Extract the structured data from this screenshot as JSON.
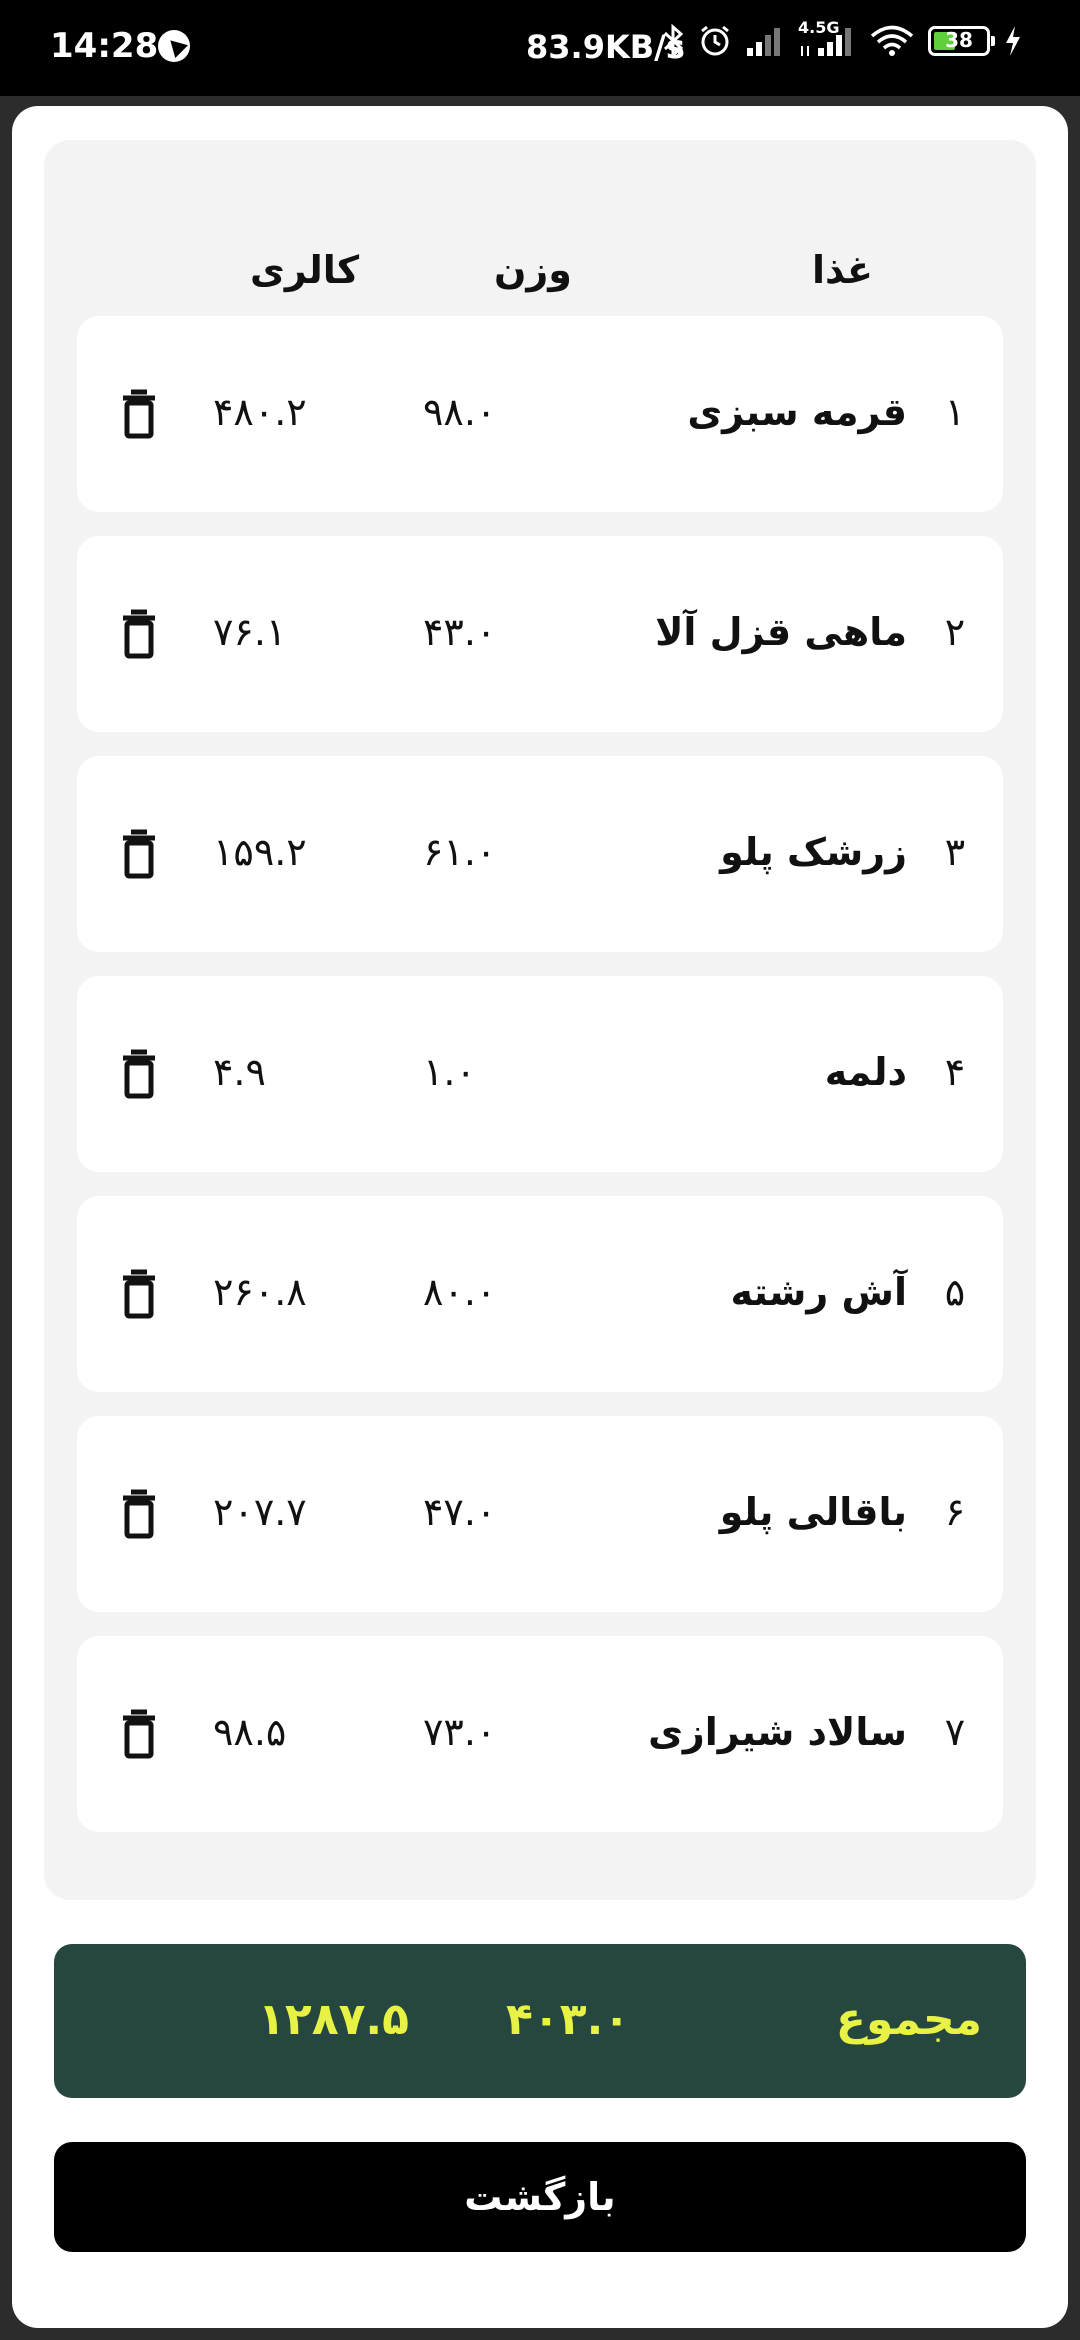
{
  "status_bar": {
    "time": "14:28",
    "speed": "83.9KB/s",
    "network_label": "4.5G",
    "battery": "38"
  },
  "table": {
    "headers": {
      "food": "غذا",
      "weight": "وزن",
      "calories": "کالری"
    },
    "rows": [
      {
        "index": "۱",
        "name": "قرمه سبزی",
        "weight": "۹۸.۰",
        "calories": "۴۸۰.۲"
      },
      {
        "index": "۲",
        "name": "ماهی قزل آلا",
        "weight": "۴۳.۰",
        "calories": "۷۶.۱"
      },
      {
        "index": "۳",
        "name": "زرشک پلو",
        "weight": "۶۱.۰",
        "calories": "۱۵۹.۲"
      },
      {
        "index": "۴",
        "name": "دلمه",
        "weight": "۱.۰",
        "calories": "۴.۹"
      },
      {
        "index": "۵",
        "name": "آش رشته",
        "weight": "۸۰.۰",
        "calories": "۲۶۰.۸"
      },
      {
        "index": "۶",
        "name": "باقالی پلو",
        "weight": "۴۷.۰",
        "calories": "۲۰۷.۷"
      },
      {
        "index": "۷",
        "name": "سالاد شیرازی",
        "weight": "۷۳.۰",
        "calories": "۹۸.۵"
      }
    ]
  },
  "total": {
    "label": "مجموع",
    "weight": "۴۰۳.۰",
    "calories": "۱۲۸۷.۵"
  },
  "back_button": {
    "label": "بازگشت"
  },
  "colors": {
    "total_bg": "#264640",
    "total_text": "#e8f244",
    "panel_bg": "#f3f3f3"
  }
}
